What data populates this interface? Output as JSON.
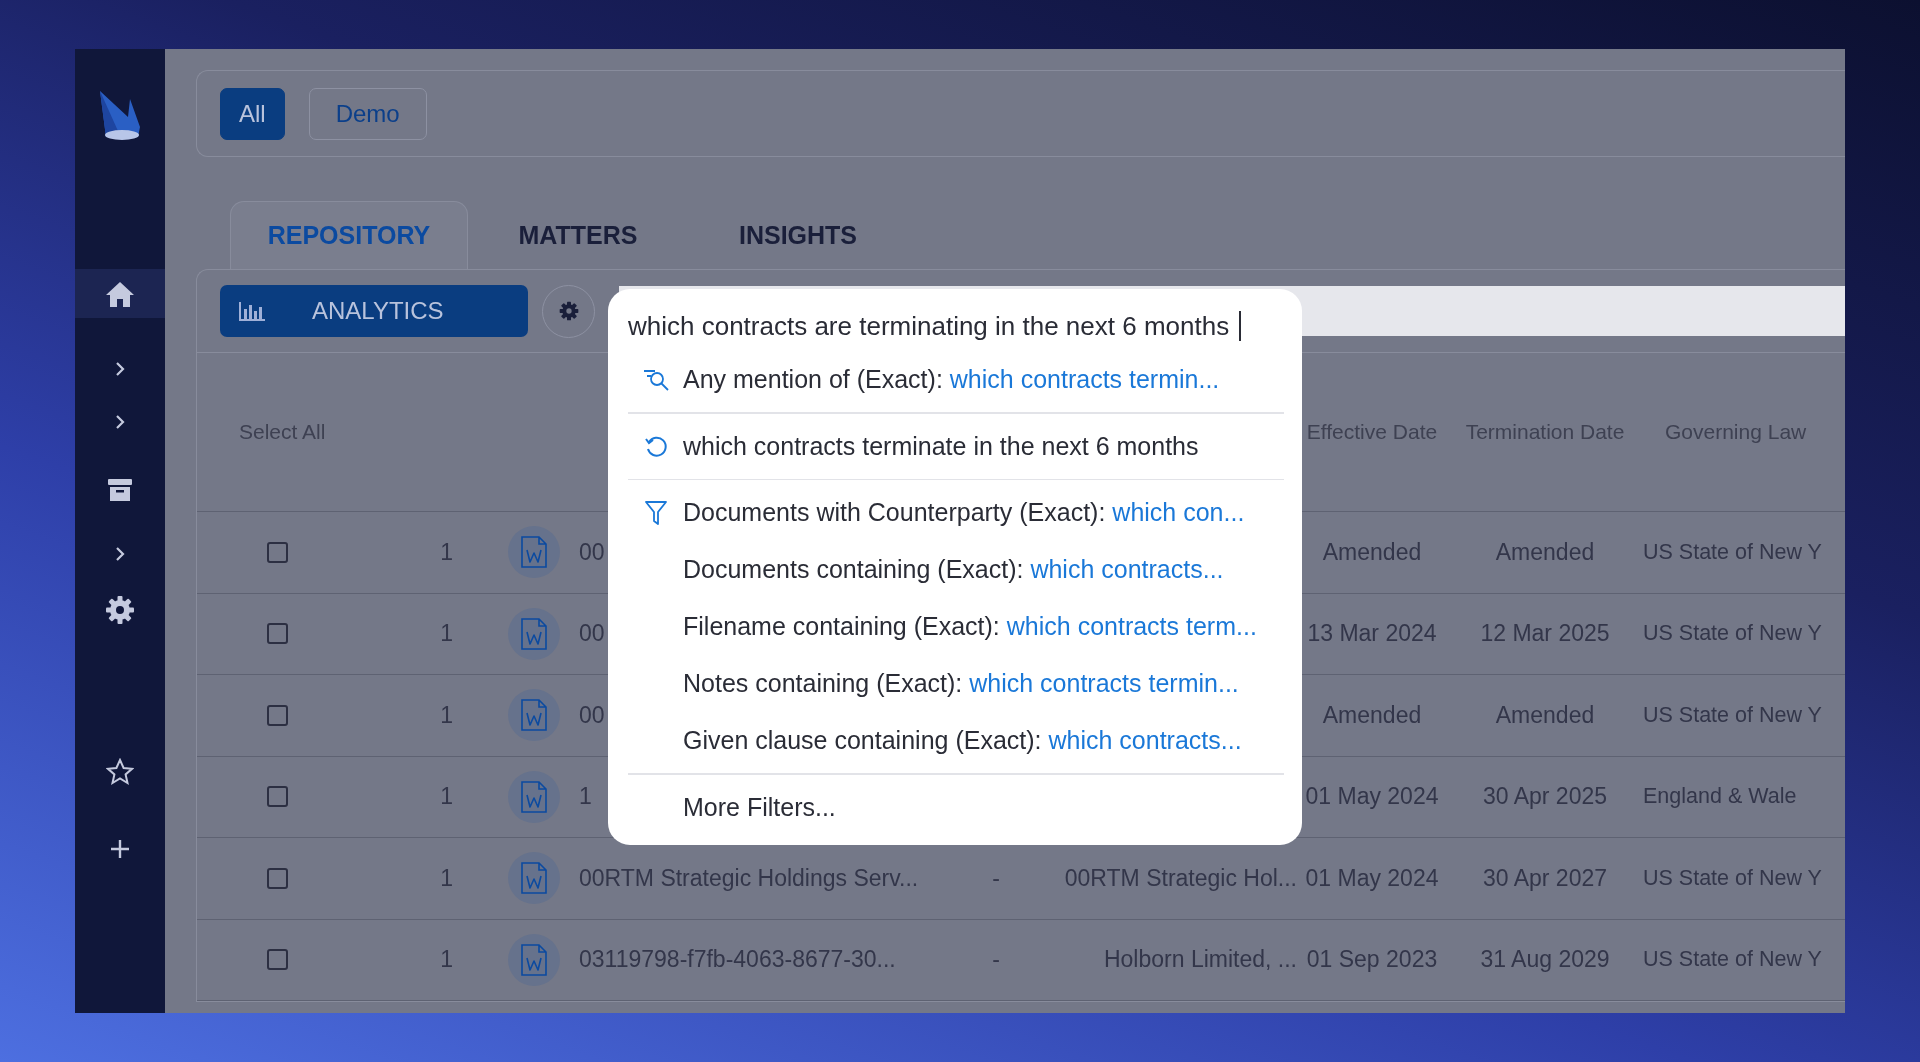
{
  "sidebar": {
    "items": [
      {
        "kind": "home",
        "selected": true
      },
      {
        "kind": "chevron",
        "selected": false
      },
      {
        "kind": "chevron",
        "selected": false
      },
      {
        "kind": "archive",
        "selected": false
      },
      {
        "kind": "chevron",
        "selected": false
      },
      {
        "kind": "settings",
        "selected": false
      },
      {
        "kind": "star",
        "selected": false
      },
      {
        "kind": "plus",
        "selected": false
      }
    ]
  },
  "filter_chips": [
    {
      "label": "All",
      "selected": true
    },
    {
      "label": "Demo",
      "selected": false
    }
  ],
  "tabs": [
    {
      "label": "REPOSITORY",
      "selected": true
    },
    {
      "label": "MATTERS",
      "selected": false
    },
    {
      "label": "INSIGHTS",
      "selected": false
    }
  ],
  "toolbar": {
    "analytics_button": "ANALYTICS"
  },
  "search": {
    "value": "which contracts are terminating in the next 6 months",
    "groups": [
      {
        "items": [
          {
            "kind": "mention",
            "label": "Any mention of (Exact):",
            "query": "which contracts termin..."
          }
        ]
      },
      {
        "items": [
          {
            "kind": "rephrase",
            "label": "which contracts terminate in the next 6 months"
          }
        ]
      },
      {
        "items": [
          {
            "kind": "filter",
            "label": "Documents with Counterparty (Exact):",
            "query": "which con..."
          },
          {
            "kind": "plain",
            "label": "Documents containing (Exact):",
            "query": "which contracts..."
          },
          {
            "kind": "plain",
            "label": "Filename containing (Exact):",
            "query": "which contracts term..."
          },
          {
            "kind": "plain",
            "label": "Notes containing (Exact):",
            "query": "which contracts termin..."
          },
          {
            "kind": "plain",
            "label": "Given clause containing (Exact):",
            "query": "which contracts..."
          }
        ]
      },
      {
        "items": [
          {
            "kind": "plain",
            "label": "More Filters..."
          }
        ]
      }
    ]
  },
  "table": {
    "select_all": "Select All",
    "columns": [
      "Effective Date",
      "Termination Date",
      "Governing Law"
    ],
    "rows": [
      {
        "checked": false,
        "count": "1",
        "name": "00",
        "effective_date": "Amended",
        "termination_date": "Amended",
        "governing_law": "US State of New Y"
      },
      {
        "checked": false,
        "count": "1",
        "name": "00",
        "effective_date": "13 Mar 2024",
        "termination_date": "12 Mar 2025",
        "governing_law": "US State of New Y"
      },
      {
        "checked": false,
        "count": "1",
        "name": "00",
        "effective_date": "Amended",
        "termination_date": "Amended",
        "governing_law": "US State of New Y"
      },
      {
        "checked": false,
        "count": "1",
        "name": "1",
        "effective_date": "01 May 2024",
        "termination_date": "30 Apr 2025",
        "governing_law": "England & Wale"
      },
      {
        "checked": false,
        "count": "1",
        "name": "00RTM Strategic Holdings Serv...",
        "dash": "-",
        "counterparty": "00RTM Strategic Hol...",
        "effective_date": "01 May 2024",
        "termination_date": "30 Apr 2027",
        "governing_law": "US State of New Y"
      },
      {
        "checked": false,
        "count": "1",
        "name": "03119798-f7fb-4063-8677-30...",
        "dash": "-",
        "counterparty": "Holborn Limited, ...",
        "effective_date": "01 Sep 2023",
        "termination_date": "31 Aug 2029",
        "governing_law": "US State of New Y"
      }
    ]
  }
}
